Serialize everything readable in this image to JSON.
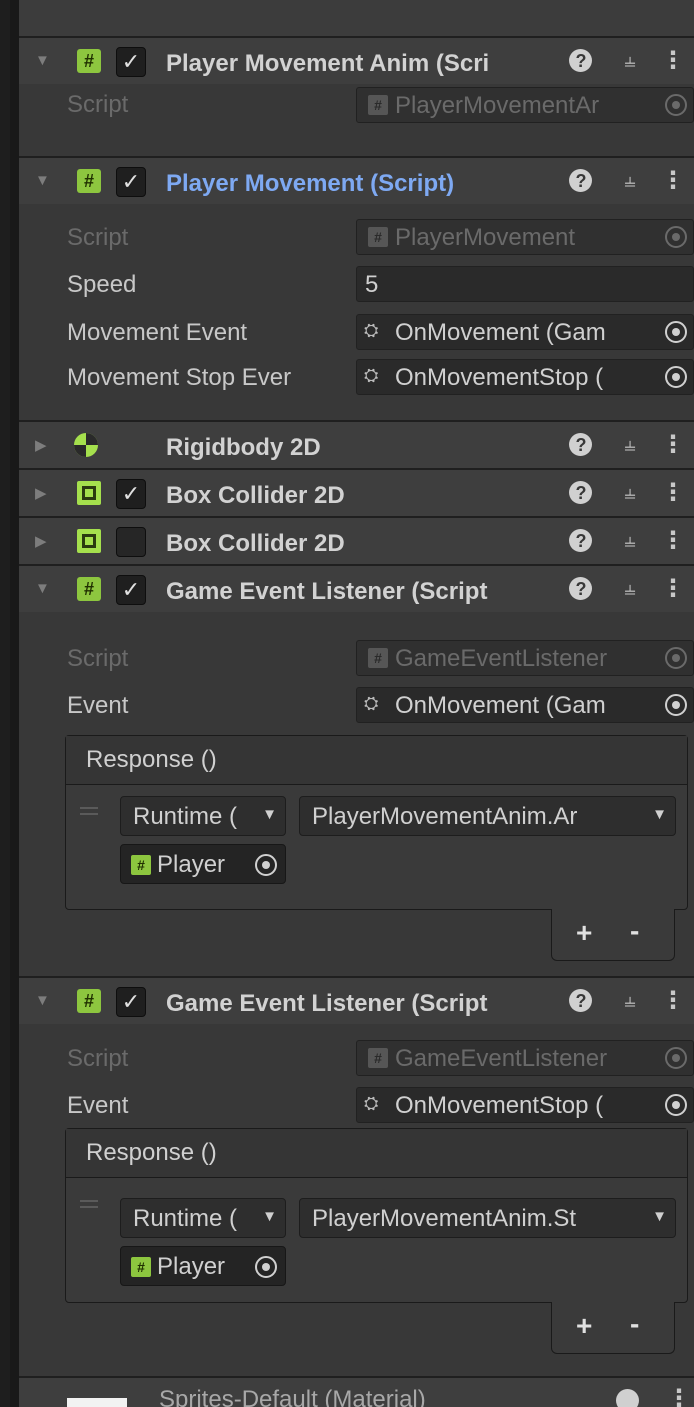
{
  "components": [
    {
      "title": "Player Movement Anim (Scri",
      "icon": "script-icon",
      "checked": true,
      "expanded": true,
      "fields": [
        {
          "label": "Script",
          "value": "PlayerMovementAr",
          "kind": "script",
          "disabled": true
        }
      ]
    },
    {
      "title": "Player Movement (Script)",
      "icon": "script-icon",
      "checked": true,
      "expanded": true,
      "selected": true,
      "fields": [
        {
          "label": "Script",
          "value": "PlayerMovement",
          "kind": "script",
          "disabled": true
        },
        {
          "label": "Speed",
          "value": "5",
          "kind": "number"
        },
        {
          "label": "Movement Event",
          "value": "OnMovement (Gam",
          "kind": "scriptable-object"
        },
        {
          "label": "Movement Stop Ever",
          "value": "OnMovementStop (",
          "kind": "scriptable-object"
        }
      ]
    },
    {
      "title": "Rigidbody 2D",
      "icon": "rigidbody-icon",
      "checked": null,
      "expanded": false
    },
    {
      "title": "Box Collider 2D",
      "icon": "box-collider-icon",
      "checked": true,
      "expanded": false
    },
    {
      "title": "Box Collider 2D",
      "icon": "box-collider-icon",
      "checked": false,
      "expanded": false
    },
    {
      "title": "Game Event Listener (Script",
      "icon": "script-icon",
      "checked": true,
      "expanded": true,
      "fields": [
        {
          "label": "Script",
          "value": "GameEventListener",
          "kind": "script",
          "disabled": true
        },
        {
          "label": "Event",
          "value": "OnMovement (Gam",
          "kind": "scriptable-object"
        }
      ],
      "response": {
        "header": "Response ()",
        "runtime": "Runtime (",
        "function": "PlayerMovementAnim.Ar",
        "target": "Player",
        "add": "+",
        "remove": "-"
      }
    },
    {
      "title": "Game Event Listener (Script",
      "icon": "script-icon",
      "checked": true,
      "expanded": true,
      "fields": [
        {
          "label": "Script",
          "value": "GameEventListener",
          "kind": "script",
          "disabled": true
        },
        {
          "label": "Event",
          "value": "OnMovementStop (",
          "kind": "scriptable-object"
        }
      ],
      "response": {
        "header": "Response ()",
        "runtime": "Runtime (",
        "function": "PlayerMovementAnim.St",
        "target": "Player",
        "add": "+",
        "remove": "-"
      }
    }
  ],
  "material": {
    "title": "Sprites-Default (Material)"
  },
  "glyphs": {
    "expanded": "▼",
    "collapsed": "▶",
    "check": "✓",
    "help": "?",
    "preset": "⫨",
    "kebab": "⋮",
    "dropdown": "▼",
    "hash": "#",
    "so": "⛭"
  },
  "colors": {
    "selected_title": "#7ea9f2",
    "script_icon": "#8dc63f",
    "collider_icon": "#a5e04d"
  }
}
